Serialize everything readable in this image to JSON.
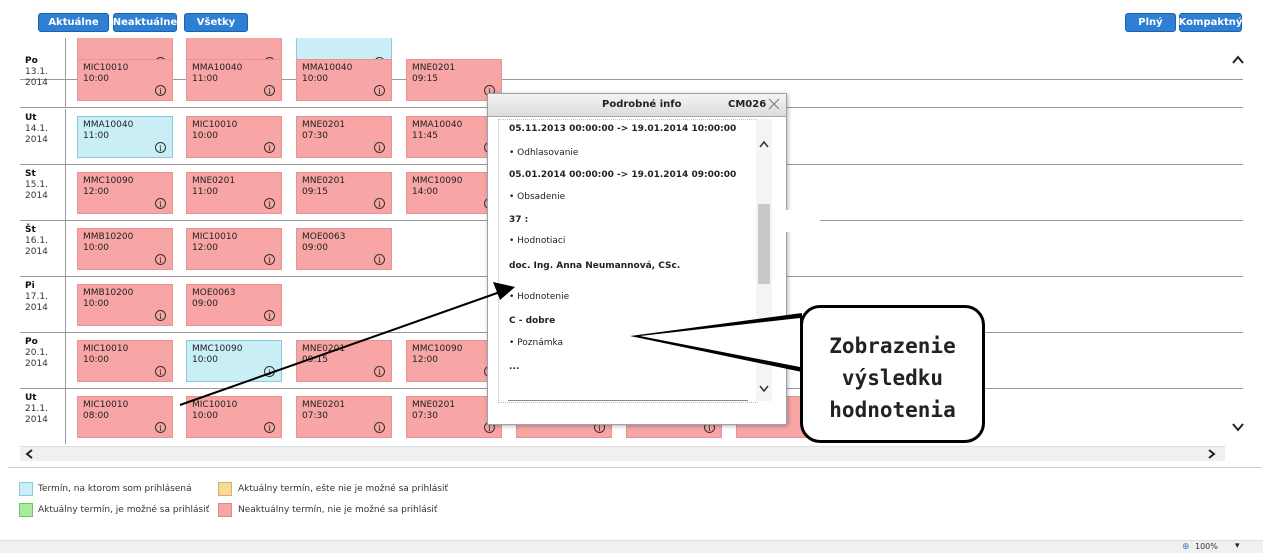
{
  "toolbar": {
    "left_buttons": [
      "Aktuálne",
      "Neaktuálne",
      "Všetky"
    ],
    "right_buttons": [
      "Plný",
      "Kompaktný"
    ]
  },
  "rows": [
    {
      "day": "",
      "date": "",
      "year": "2014",
      "cards": [
        {
          "code": "",
          "time": "",
          "color": "pink"
        },
        {
          "code": "",
          "time": "",
          "color": "pink"
        },
        {
          "code": "",
          "time": "",
          "color": "blue"
        }
      ]
    },
    {
      "day": "Po",
      "date": "13.1.",
      "year": "2014",
      "cards": [
        {
          "code": "MIC10010",
          "time": "10:00",
          "color": "pink"
        },
        {
          "code": "MMA10040",
          "time": "11:00",
          "color": "pink"
        },
        {
          "code": "MMA10040",
          "time": "10:00",
          "color": "pink"
        },
        {
          "code": "MNE0201",
          "time": "09:15",
          "color": "pink"
        }
      ]
    },
    {
      "day": "Ut",
      "date": "14.1.",
      "year": "2014",
      "cards": [
        {
          "code": "MMA10040",
          "time": "11:00",
          "color": "blue"
        },
        {
          "code": "MIC10010",
          "time": "10:00",
          "color": "pink"
        },
        {
          "code": "MNE0201",
          "time": "07:30",
          "color": "pink"
        },
        {
          "code": "MMA10040",
          "time": "11:45",
          "color": "pink"
        }
      ]
    },
    {
      "day": "St",
      "date": "15.1.",
      "year": "2014",
      "cards": [
        {
          "code": "MMC10090",
          "time": "12:00",
          "color": "pink"
        },
        {
          "code": "MNE0201",
          "time": "11:00",
          "color": "pink"
        },
        {
          "code": "MNE0201",
          "time": "09:15",
          "color": "pink"
        },
        {
          "code": "MMC10090",
          "time": "14:00",
          "color": "pink"
        }
      ]
    },
    {
      "day": "Št",
      "date": "16.1.",
      "year": "2014",
      "cards": [
        {
          "code": "MMB10200",
          "time": "10:00",
          "color": "pink"
        },
        {
          "code": "MIC10010",
          "time": "12:00",
          "color": "pink"
        },
        {
          "code": "MOE0063",
          "time": "09:00",
          "color": "pink"
        }
      ]
    },
    {
      "day": "Pi",
      "date": "17.1.",
      "year": "2014",
      "cards": [
        {
          "code": "MMB10200",
          "time": "10:00",
          "color": "pink"
        },
        {
          "code": "MOE0063",
          "time": "09:00",
          "color": "pink"
        }
      ]
    },
    {
      "day": "Po",
      "date": "20.1.",
      "year": "2014",
      "cards": [
        {
          "code": "MIC10010",
          "time": "10:00",
          "color": "pink"
        },
        {
          "code": "MMC10090",
          "time": "10:00",
          "color": "blue"
        },
        {
          "code": "MNE0201",
          "time": "09:15",
          "color": "pink"
        },
        {
          "code": "MMC10090",
          "time": "12:00",
          "color": "pink"
        }
      ]
    },
    {
      "day": "Ut",
      "date": "21.1.",
      "year": "2014",
      "cards": [
        {
          "code": "MIC10010",
          "time": "08:00",
          "color": "pink"
        },
        {
          "code": "MIC10010",
          "time": "10:00",
          "color": "pink"
        },
        {
          "code": "MNE0201",
          "time": "07:30",
          "color": "pink"
        },
        {
          "code": "MNE0201",
          "time": "07:30",
          "color": "pink"
        },
        {
          "code": "",
          "time": "",
          "color": "pink"
        },
        {
          "code": "",
          "time": "",
          "color": "pink"
        },
        {
          "code": "",
          "time": "",
          "color": "pink"
        }
      ]
    }
  ],
  "popup": {
    "title": "Podrobné info",
    "code": "CM026",
    "lines": [
      {
        "text": "05.11.2013 00:00:00 -> 19.01.2014 10:00:00",
        "bold": true
      },
      {
        "text": "•  Odhlasovanie",
        "bold": false
      },
      {
        "text": "05.01.2014 00:00:00 -> 19.01.2014 09:00:00",
        "bold": true
      },
      {
        "text": "•  Obsadenie",
        "bold": false
      },
      {
        "text": "37 :",
        "bold": true
      },
      {
        "text": "•  Hodnotiaci",
        "bold": false
      },
      {
        "text": "doc. Ing. Anna Neumannová, CSc.",
        "bold": true
      },
      {
        "text": "•  Hodnotenie",
        "bold": false
      },
      {
        "text": "C - dobre",
        "bold": true
      },
      {
        "text": "•  Poznámka",
        "bold": false
      },
      {
        "text": "...",
        "bold": true
      }
    ]
  },
  "callout": {
    "lines": [
      "Zobrazenie",
      "výsledku",
      "hodnotenia"
    ]
  },
  "legend": [
    {
      "text": "Termín, na ktorom som prihlásená",
      "color": "#c9eef6"
    },
    {
      "text": "Aktuálny termín, ešte nie je možné sa prihlásiť",
      "color": "#f9d99a"
    },
    {
      "text": "Aktuálny termín, je možné sa prihlásiť",
      "color": "#a9ea9f"
    },
    {
      "text": "Neaktuálny termín, nie je možné sa prihlásiť",
      "color": "#f8a5a5"
    }
  ],
  "zoom": "100%",
  "icons": {
    "info": "info-icon",
    "close": "close-icon",
    "scroll_up": "chevron-up-icon",
    "scroll_down": "chevron-down-icon",
    "scroll_left": "chevron-left-icon",
    "scroll_right": "chevron-right-icon"
  }
}
